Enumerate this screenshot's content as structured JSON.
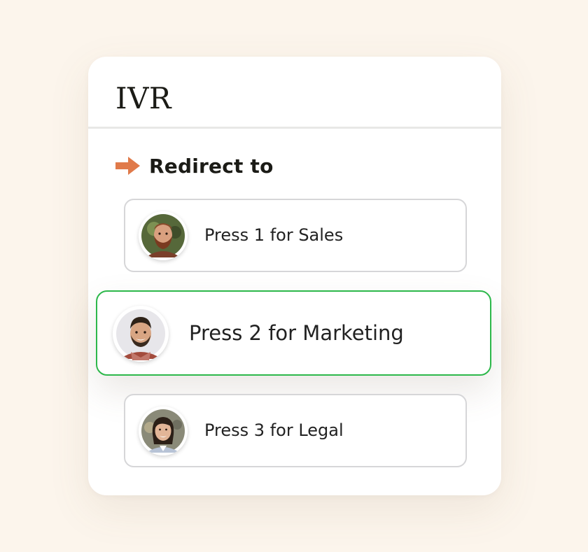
{
  "card": {
    "title": "IVR",
    "section": {
      "icon": "arrow-right-icon",
      "label": "Redirect to",
      "accent": "#e07a4a"
    }
  },
  "options": [
    {
      "label": "Press 1 for Sales",
      "avatar": "man-with-beard-avatar",
      "selected": false
    },
    {
      "label": "Press 2 for Marketing",
      "avatar": "smiling-man-avatar",
      "selected": true,
      "border_color": "#2db84b"
    },
    {
      "label": "Press 3 for Legal",
      "avatar": "smiling-woman-avatar",
      "selected": false
    }
  ],
  "colors": {
    "background": "#fcf5ec",
    "card": "#ffffff",
    "selected_border": "#2db84b",
    "default_border": "#d6d6d8",
    "arrow": "#e07a4a"
  }
}
